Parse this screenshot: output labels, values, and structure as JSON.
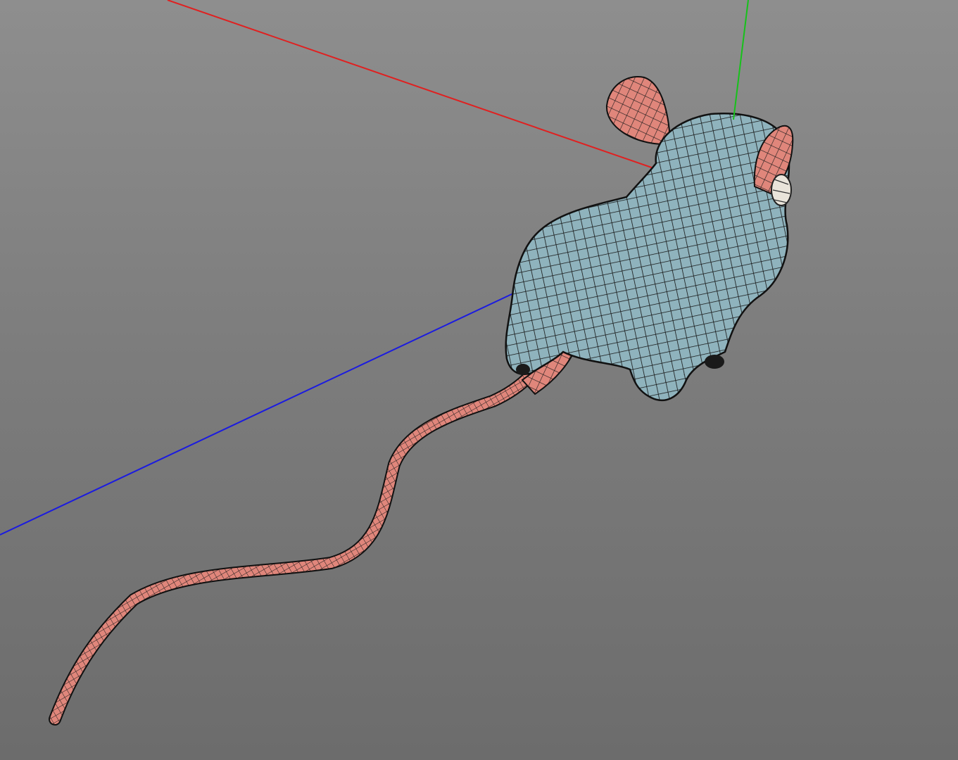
{
  "viewport": {
    "background_top": "#8e8e8e",
    "background_bottom": "#6c6c6c"
  },
  "axes": {
    "x_color": "#e02020",
    "y_color": "#16c21a",
    "z_color": "#1b1be0"
  },
  "model": {
    "body_color": "#8fb3bd",
    "skin_color": "#e0867b",
    "wire_color": "#111111"
  }
}
